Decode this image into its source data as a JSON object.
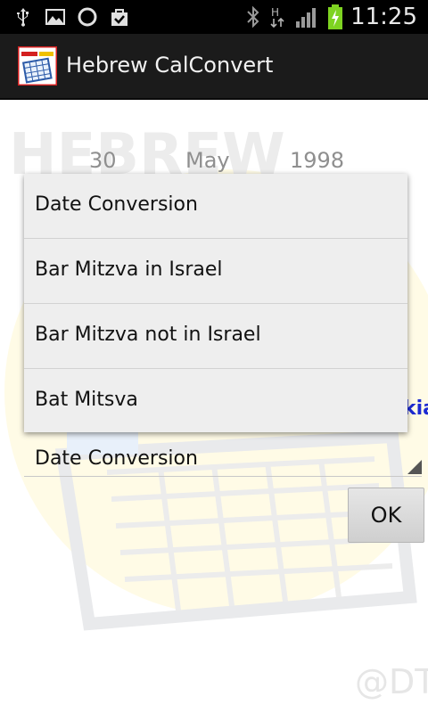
{
  "status_bar": {
    "time": "11:25",
    "icons": [
      "usb-icon",
      "gallery-icon",
      "sync-icon",
      "bag-icon",
      "bluetooth-icon",
      "hspa-network-icon",
      "signal-icon",
      "battery-charging-icon"
    ]
  },
  "action_bar": {
    "title": "Hebrew CalConvert",
    "icon": "hebrew-calendar-app-icon"
  },
  "date_picker": {
    "day": "30",
    "month": "May",
    "year": "1998"
  },
  "dropdown": {
    "items": [
      {
        "label": "Date Conversion"
      },
      {
        "label": "Bar Mitzva in Israel"
      },
      {
        "label": "Bar Mitzva not in Israel"
      },
      {
        "label": "Bat Mitsva"
      }
    ]
  },
  "partial_text": "kia",
  "spinner": {
    "selected": "Date Conversion"
  },
  "ok_button": {
    "label": "OK"
  },
  "watermark": "@DT",
  "colors": {
    "status_bar_bg": "#000000",
    "action_bar_bg": "#1b1b1b",
    "dropdown_bg": "#eeeeee",
    "blue_text": "#1d2bd2"
  }
}
